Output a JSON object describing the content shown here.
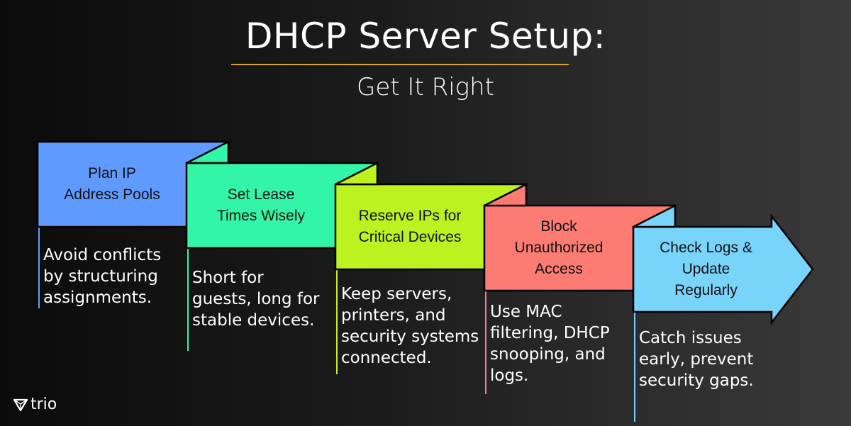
{
  "header": {
    "title": "DHCP Server Setup:",
    "subtitle": "Get It Right",
    "underline_color": "#d9a12a"
  },
  "steps": [
    {
      "title_lines": [
        "Plan IP",
        "Address Pools"
      ],
      "description_lines": [
        "Avoid conflicts",
        "by structuring",
        "assignments."
      ],
      "color": "#5f9bff",
      "shape": "flag"
    },
    {
      "title_lines": [
        "Set Lease",
        "Times Wisely"
      ],
      "description_lines": [
        "Short for",
        "guests, long for",
        "stable devices."
      ],
      "color": "#33f5a7",
      "shape": "flag"
    },
    {
      "title_lines": [
        "Reserve IPs for",
        "Critical Devices"
      ],
      "description_lines": [
        "Keep servers,",
        "printers, and",
        "security systems",
        "connected."
      ],
      "color": "#bbf21f",
      "shape": "flag"
    },
    {
      "title_lines": [
        "Block",
        "Unauthorized",
        "Access"
      ],
      "description_lines": [
        "Use MAC",
        "filtering, DHCP",
        "snooping, and",
        "logs."
      ],
      "color": "#fc7b73",
      "shape": "flag"
    },
    {
      "title_lines": [
        "Check Logs &",
        "Update",
        "Regularly"
      ],
      "description_lines": [
        "Catch issues",
        "early, prevent",
        "security gaps."
      ],
      "color": "#78d4fb",
      "shape": "arrow"
    }
  ],
  "logo": {
    "text": "trio",
    "icon": "trio-logo-icon"
  }
}
